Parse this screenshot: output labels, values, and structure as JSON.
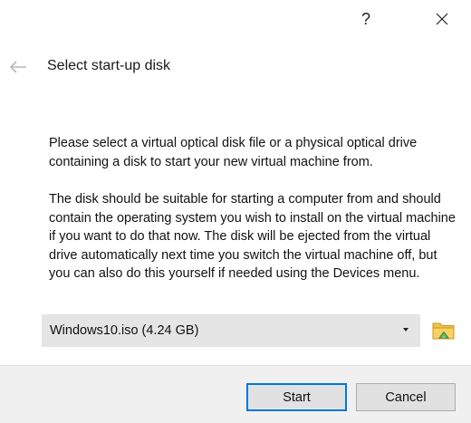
{
  "titlebar": {
    "help_label": "?",
    "help_icon": "question-mark-icon",
    "close_icon": "close-icon"
  },
  "header": {
    "back_icon": "back-arrow-icon",
    "title": "Select start-up disk"
  },
  "body": {
    "paragraph1": "Please select a virtual optical disk file or a physical optical drive containing a disk to start your new virtual machine from.",
    "paragraph2": "The disk should be suitable for starting a computer from and should contain the operating system you wish to install on the virtual machine if you want to do that now. The disk will be ejected from the virtual drive automatically next time you switch the virtual machine off, but you can also do this yourself if needed using the Devices menu."
  },
  "disk_selector": {
    "selected_value": "Windows10.iso (4.24 GB)",
    "dropdown_icon": "dropdown-arrow-icon",
    "browse_icon": "folder-icon"
  },
  "footer": {
    "start_label": "Start",
    "cancel_label": "Cancel"
  },
  "colors": {
    "default_button_border": "#0078d7",
    "combo_background": "#e5e5e5",
    "footer_background": "#f0f0f0",
    "folder_yellow": "#f5c242",
    "folder_green": "#5cb85c"
  }
}
